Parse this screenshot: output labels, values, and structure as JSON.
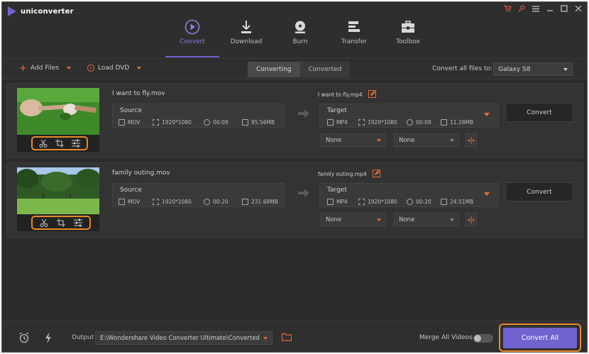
{
  "app": {
    "title": "uniconverter"
  },
  "nav": [
    {
      "label": "Convert",
      "icon": "convert-icon",
      "active": true
    },
    {
      "label": "Download",
      "icon": "download-icon"
    },
    {
      "label": "Burn",
      "icon": "burn-icon"
    },
    {
      "label": "Transfer",
      "icon": "transfer-icon"
    },
    {
      "label": "Toolbox",
      "icon": "toolbox-icon"
    }
  ],
  "toolbar": {
    "add_files": "Add Files",
    "load_dvd": "Load DVD",
    "tabs": [
      "Converting",
      "Converted"
    ],
    "active_tab": "Converting",
    "convert_all_label": "Convert all files to:",
    "device": "Galaxy S8"
  },
  "files": [
    {
      "name": "I want to fly.mov",
      "source": {
        "label": "Source",
        "format": "MOV",
        "resolution": "1920*1080",
        "duration": "00:09",
        "size": "85.56MB"
      },
      "target_name": "I want to fly.mp4",
      "target": {
        "label": "Target",
        "format": "MP4",
        "resolution": "1920*1080",
        "duration": "00:09",
        "size": "11.28MB"
      },
      "subtitle": "None",
      "audio": "None",
      "convert_label": "Convert"
    },
    {
      "name": "family outing.mov",
      "source": {
        "label": "Source",
        "format": "MOV",
        "resolution": "1920*1080",
        "duration": "00:20",
        "size": "231.68MB"
      },
      "target_name": "family outing.mp4",
      "target": {
        "label": "Target",
        "format": "MP4",
        "resolution": "1920*1080",
        "duration": "00:20",
        "size": "24.51MB"
      },
      "subtitle": "None",
      "audio": "None",
      "convert_label": "Convert"
    }
  ],
  "bottom": {
    "output_label": "Output",
    "output_path": "E:\\Wondershare Video Converter Ultimate\\Converted",
    "merge_label": "Merge All Videos",
    "merge_enabled": false,
    "convert_all": "Convert All"
  },
  "colors": {
    "accent": "#7063cf",
    "highlight": "#e88a2a",
    "orange_icon": "#e86c3a"
  }
}
